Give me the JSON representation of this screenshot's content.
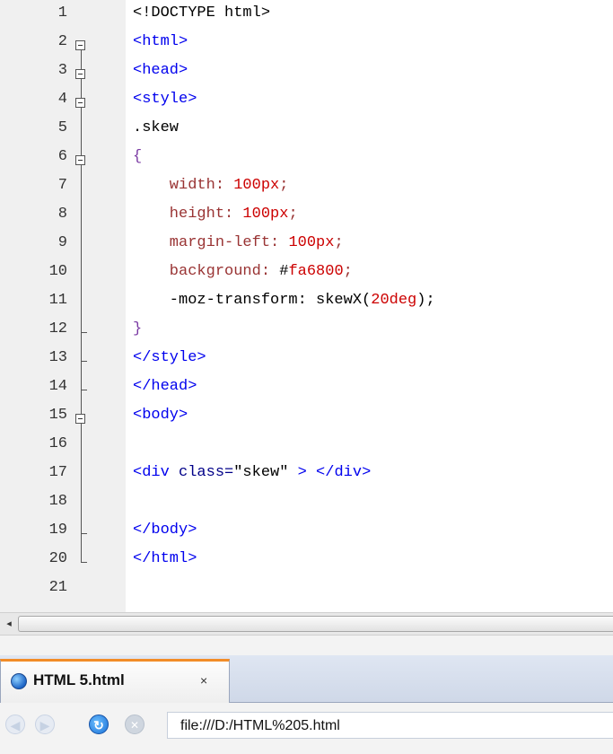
{
  "editor": {
    "lines": [
      {
        "n": "1",
        "tokens": [
          {
            "t": "<!DOCTYPE html>",
            "c": "doctype"
          }
        ]
      },
      {
        "n": "2",
        "tokens": [
          {
            "t": "<html>",
            "c": "tag"
          }
        ]
      },
      {
        "n": "3",
        "tokens": [
          {
            "t": "<head>",
            "c": "tag"
          }
        ]
      },
      {
        "n": "4",
        "tokens": [
          {
            "t": "<style>",
            "c": "tag"
          }
        ]
      },
      {
        "n": "5",
        "tokens": [
          {
            "t": ".skew",
            "c": "sel"
          }
        ]
      },
      {
        "n": "6",
        "tokens": [
          {
            "t": "{",
            "c": "brace"
          }
        ]
      },
      {
        "n": "7",
        "tokens": [
          {
            "t": "    width: ",
            "c": "prop"
          },
          {
            "t": "100px",
            "c": "num"
          },
          {
            "t": ";",
            "c": "prop"
          }
        ]
      },
      {
        "n": "8",
        "tokens": [
          {
            "t": "    height: ",
            "c": "prop"
          },
          {
            "t": "100px",
            "c": "num"
          },
          {
            "t": ";",
            "c": "prop"
          }
        ]
      },
      {
        "n": "9",
        "tokens": [
          {
            "t": "    margin-left: ",
            "c": "prop"
          },
          {
            "t": "100px",
            "c": "num"
          },
          {
            "t": ";",
            "c": "prop"
          }
        ]
      },
      {
        "n": "10",
        "tokens": [
          {
            "t": "    background: ",
            "c": "prop"
          },
          {
            "t": "#",
            "c": "hash"
          },
          {
            "t": "fa6800",
            "c": "num"
          },
          {
            "t": ";",
            "c": "prop"
          }
        ]
      },
      {
        "n": "11",
        "tokens": [
          {
            "t": "    -moz-transform: skewX",
            "c": "plain"
          },
          {
            "t": "(",
            "c": "paren"
          },
          {
            "t": "20deg",
            "c": "num"
          },
          {
            "t": ");",
            "c": "paren"
          }
        ]
      },
      {
        "n": "12",
        "tokens": [
          {
            "t": "}",
            "c": "brace"
          }
        ]
      },
      {
        "n": "13",
        "tokens": [
          {
            "t": "</style>",
            "c": "tag"
          }
        ]
      },
      {
        "n": "14",
        "tokens": [
          {
            "t": "</head>",
            "c": "tag"
          }
        ]
      },
      {
        "n": "15",
        "tokens": [
          {
            "t": "<body>",
            "c": "tag"
          }
        ]
      },
      {
        "n": "16",
        "tokens": []
      },
      {
        "n": "17",
        "tokens": [
          {
            "t": "<div ",
            "c": "tag"
          },
          {
            "t": "class=",
            "c": "attr"
          },
          {
            "t": "\"skew\"",
            "c": "str"
          },
          {
            "t": " > </div>",
            "c": "tag"
          }
        ]
      },
      {
        "n": "18",
        "tokens": []
      },
      {
        "n": "19",
        "tokens": [
          {
            "t": "</body>",
            "c": "tag"
          }
        ]
      },
      {
        "n": "20",
        "tokens": [
          {
            "t": "</html>",
            "c": "tag"
          }
        ]
      },
      {
        "n": "21",
        "tokens": []
      }
    ],
    "fold": {
      "boxes": [
        "2",
        "3",
        "4",
        "6",
        "15"
      ],
      "ticks": [
        "12",
        "13",
        "14",
        "19"
      ],
      "end": "20"
    }
  },
  "scrollbar": {
    "left_arrow": "◂"
  },
  "tab": {
    "title": "HTML 5.html",
    "close": "×",
    "icon": "firefox-globe-icon",
    "accent": "#f28c28"
  },
  "nav": {
    "back_icon": "back-arrow-icon",
    "forward_icon": "forward-arrow-icon",
    "reload_icon": "reload-icon",
    "stop_icon": "stop-icon",
    "url": "file:///D:/HTML%205.html"
  }
}
